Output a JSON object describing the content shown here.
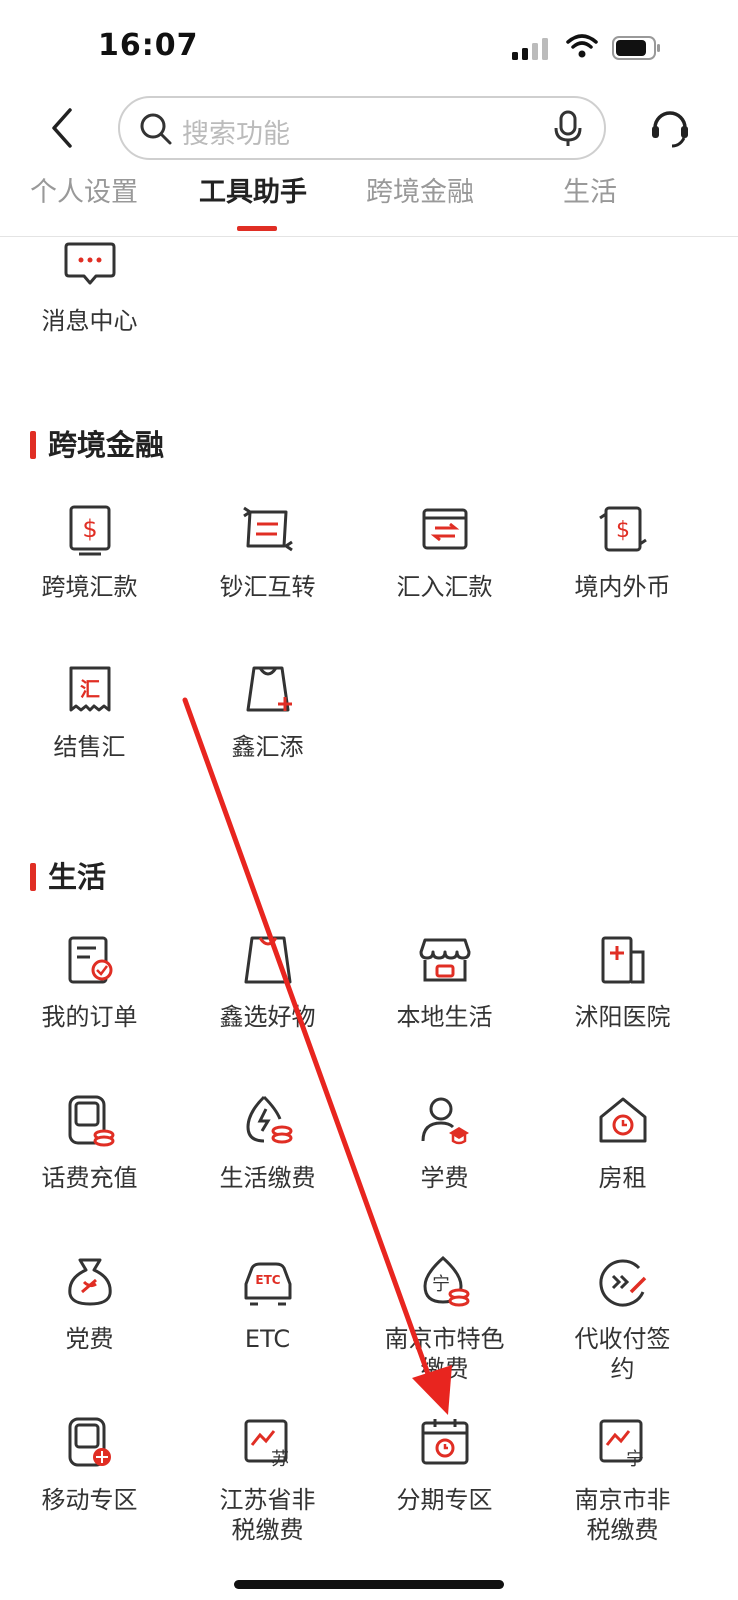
{
  "status": {
    "time": "16:07"
  },
  "search": {
    "placeholder": "搜索功能"
  },
  "tabs": [
    {
      "label": "个人设置"
    },
    {
      "label": "工具助手",
      "active": true
    },
    {
      "label": "跨境金融"
    },
    {
      "label": "生活"
    }
  ],
  "tools": {
    "items": [
      {
        "label": "消息中心",
        "icon": "message-center-icon"
      }
    ]
  },
  "cross_border": {
    "title": "跨境金融",
    "items": [
      {
        "label": "跨境汇款",
        "icon": "cross-border-remittance-icon"
      },
      {
        "label": "钞汇互转",
        "icon": "cash-exchange-icon"
      },
      {
        "label": "汇入汇款",
        "icon": "inward-remittance-icon"
      },
      {
        "label": "境内外币",
        "icon": "domestic-foreign-currency-icon"
      },
      {
        "label": "结售汇",
        "icon": "fx-settlement-icon"
      },
      {
        "label": "鑫汇添",
        "icon": "xinhuitian-icon"
      }
    ]
  },
  "life": {
    "title": "生活",
    "items": [
      {
        "label": "我的订单",
        "icon": "my-orders-icon"
      },
      {
        "label": "鑫选好物",
        "icon": "shopping-bag-icon"
      },
      {
        "label": "本地生活",
        "icon": "local-store-icon"
      },
      {
        "label": "沭阳医院",
        "icon": "hospital-icon"
      },
      {
        "label": "话费充值",
        "icon": "phone-topup-icon"
      },
      {
        "label": "生活缴费",
        "icon": "utility-payment-icon"
      },
      {
        "label": "学费",
        "icon": "tuition-icon"
      },
      {
        "label": "房租",
        "icon": "rent-icon"
      },
      {
        "label": "党费",
        "icon": "party-fee-icon"
      },
      {
        "label": "ETC",
        "icon": "etc-icon"
      },
      {
        "label": "南京市特色缴费",
        "icon": "nanjing-payment-icon"
      },
      {
        "label": "代收付签约",
        "icon": "collection-payment-icon"
      },
      {
        "label": "移动专区",
        "icon": "mobile-zone-icon"
      },
      {
        "label": "江苏省非税缴费",
        "icon": "jiangsu-nontax-icon"
      },
      {
        "label": "分期专区",
        "icon": "installment-zone-icon"
      },
      {
        "label": "南京市非税缴费",
        "icon": "nanjing-nontax-icon"
      }
    ]
  },
  "colors": {
    "accent": "#e02e24",
    "icon_stroke": "#333333",
    "text": "#333333"
  }
}
